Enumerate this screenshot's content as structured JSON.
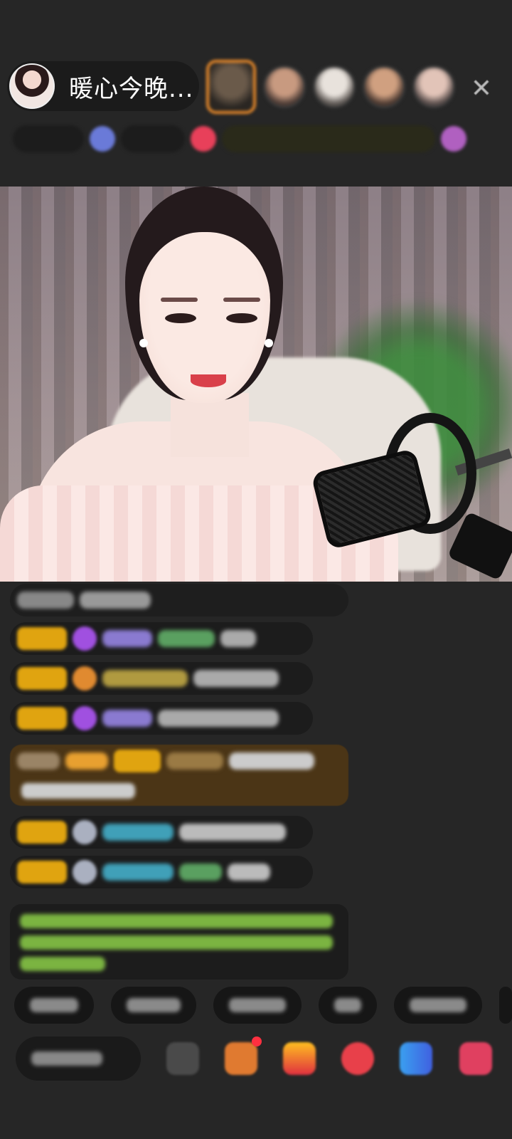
{
  "header": {
    "host_name": "暖心今晚...",
    "close_icon": "close-icon",
    "viewer_count": 5
  },
  "colors": {
    "background": "#262626",
    "badge_gold": "#e0a410",
    "top_viewer_border": "#e98a2a",
    "notice_brown": "#4b3516",
    "notice_green_text": "#8ccf48"
  },
  "chat": {
    "message_count": 7,
    "system_notice_present": true
  },
  "quick_replies_count": 6,
  "toolbar": {
    "comment_placeholder_icon": "comment-input",
    "buttons": [
      "emoji-icon",
      "gift-box-icon",
      "red-envelope-icon",
      "pk-icon",
      "share-icon",
      "more-icon"
    ]
  }
}
